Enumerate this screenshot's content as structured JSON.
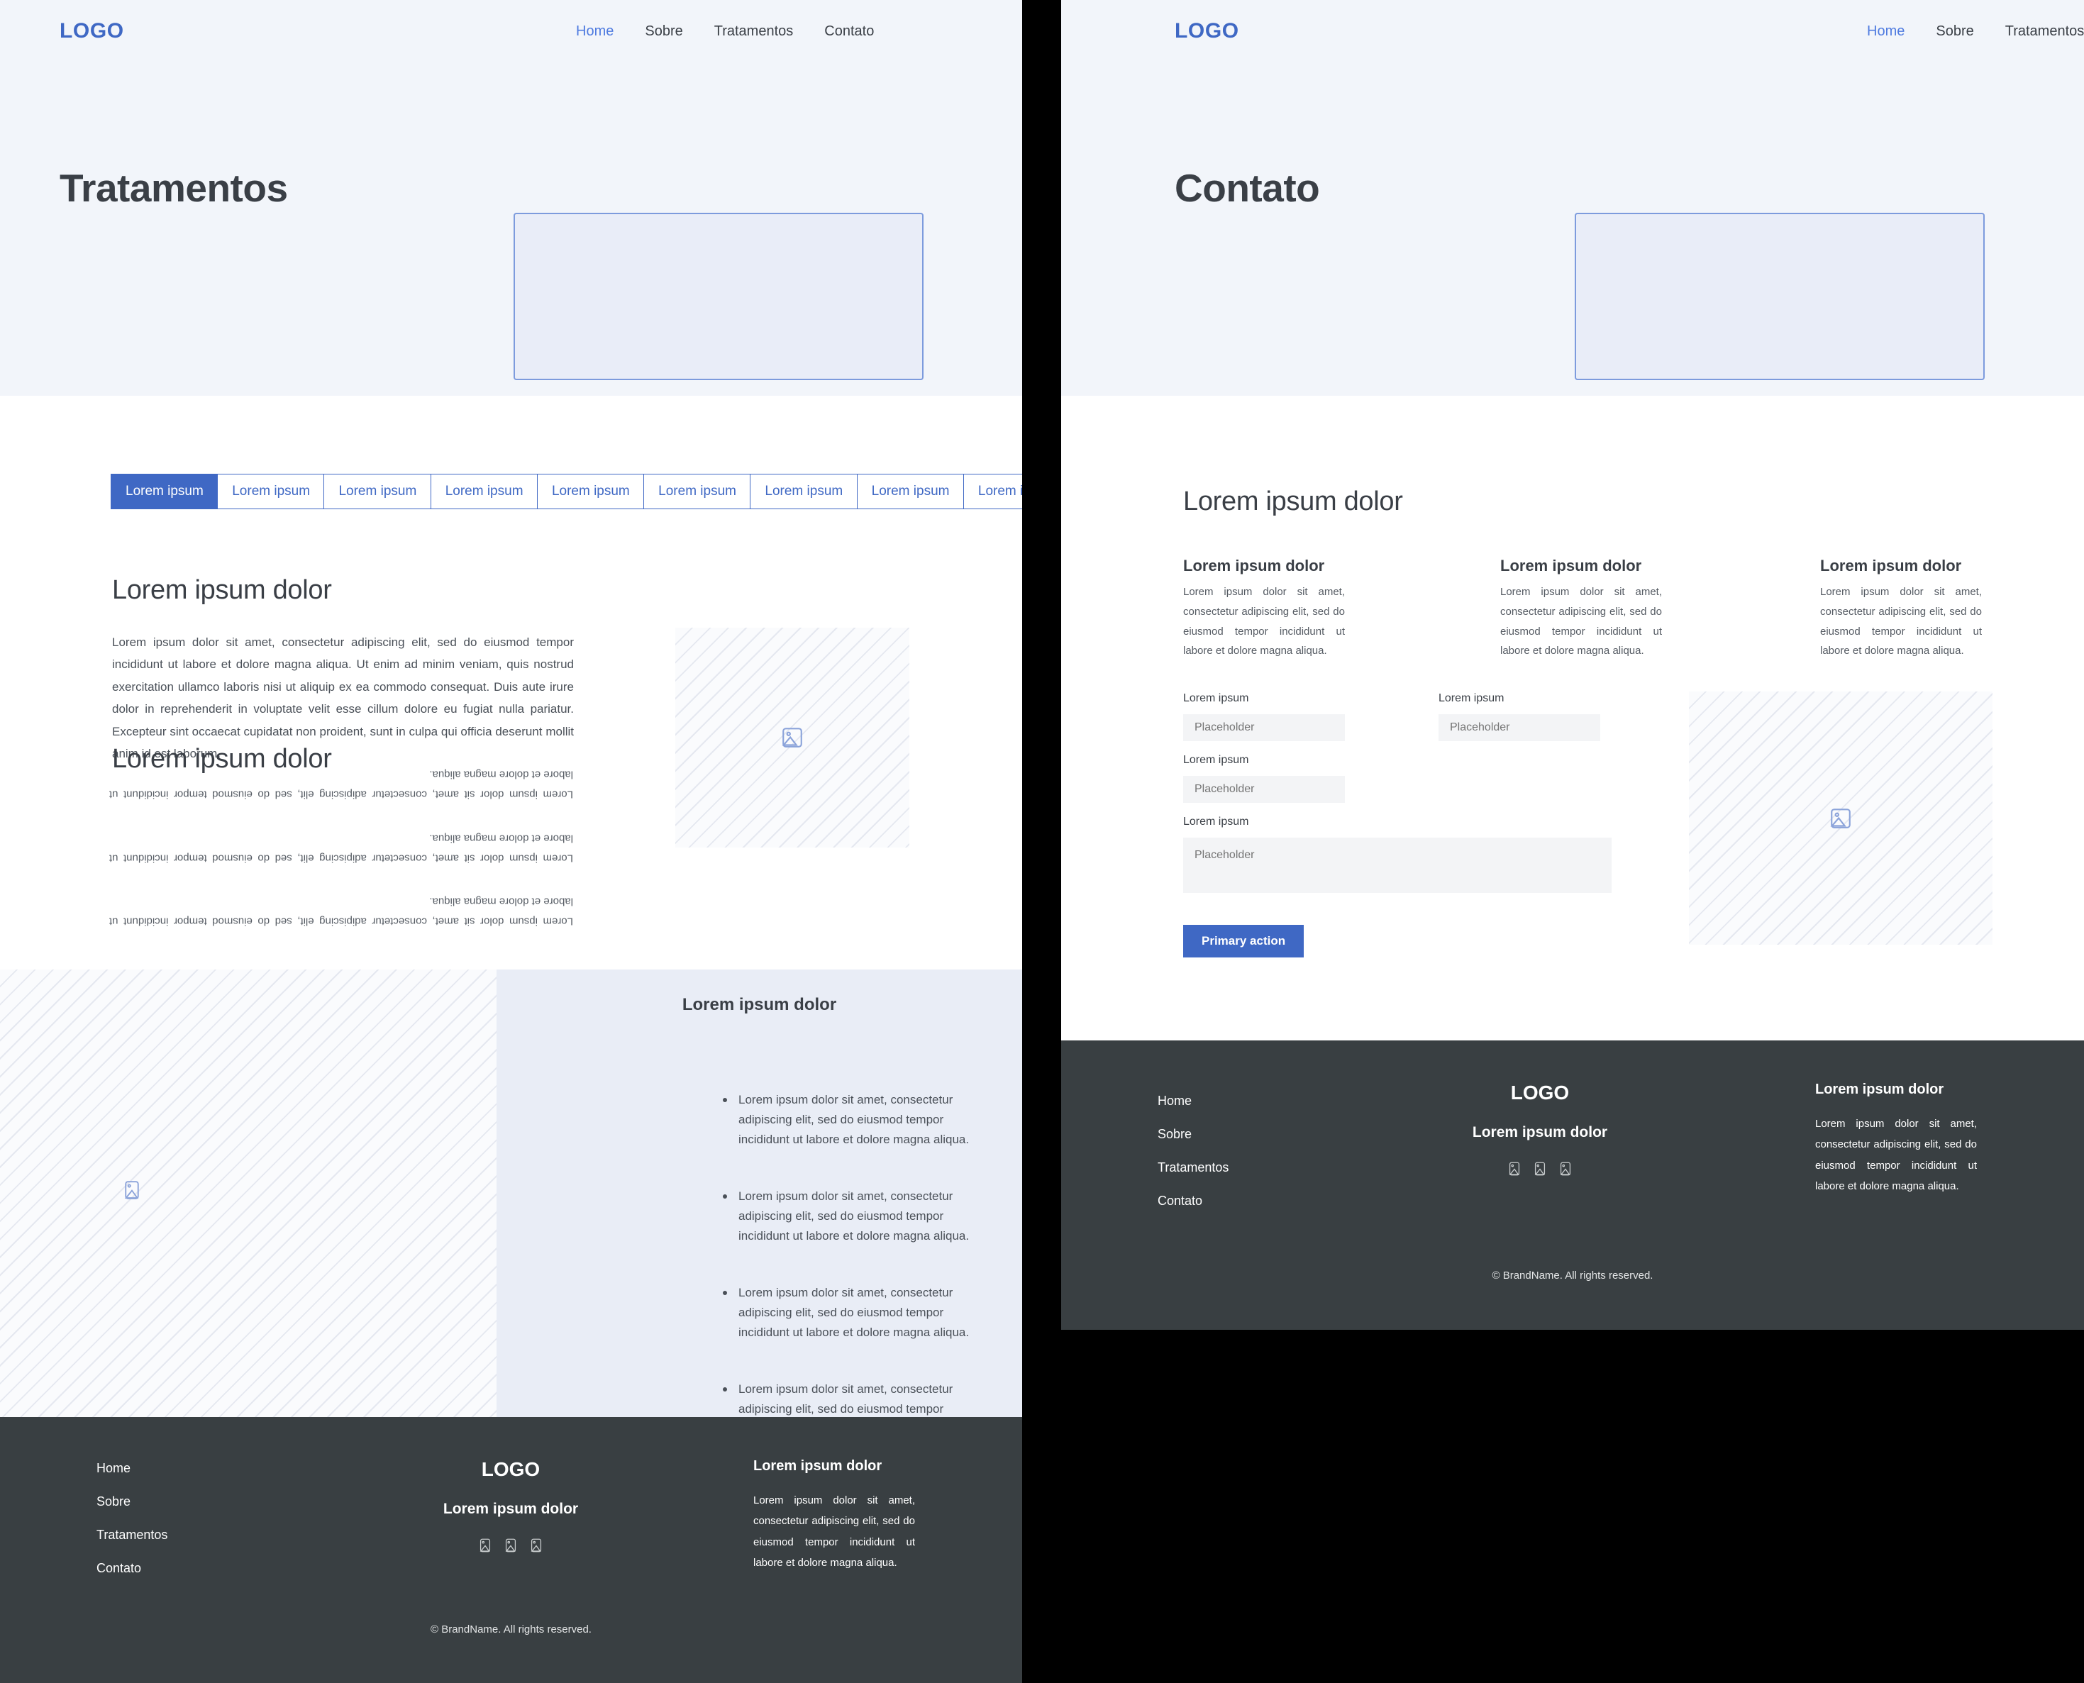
{
  "brand": {
    "logo": "LOGO",
    "accent": "#3f68c4",
    "footer_bg": "#393f42",
    "hero_bg": "#f2f5fa"
  },
  "nav": {
    "items": [
      {
        "label": "Home",
        "active": true
      },
      {
        "label": "Sobre",
        "active": false
      },
      {
        "label": "Tratamentos",
        "active": false
      },
      {
        "label": "Contato",
        "active": false
      }
    ]
  },
  "left_page": {
    "hero_title": "Tratamentos",
    "tabs": [
      {
        "label": "Lorem ipsum",
        "active": true
      },
      {
        "label": "Lorem ipsum",
        "active": false
      },
      {
        "label": "Lorem ipsum",
        "active": false
      },
      {
        "label": "Lorem ipsum",
        "active": false
      },
      {
        "label": "Lorem ipsum",
        "active": false
      },
      {
        "label": "Lorem ipsum",
        "active": false
      },
      {
        "label": "Lorem ipsum",
        "active": false
      },
      {
        "label": "Lorem ipsum",
        "active": false
      },
      {
        "label": "Lorem ipsum",
        "active": false
      }
    ],
    "section_heading": "Lorem ipsum dolor",
    "section_paragraph": "Lorem ipsum dolor sit amet, consectetur adipiscing elit, sed do eiusmod tempor incididunt ut labore et dolore magna aliqua. Ut enim ad minim veniam, quis nostrud exercitation ullamco laboris nisi ut aliquip ex ea commodo consequat. Duis aute irure dolor in reprehenderit in voluptate velit esse cillum dolore eu fugiat nulla pariatur. Excepteur sint occaecat cupidatat non proident, sunt in culpa qui officia deserunt mollit anim id est laborum.",
    "second_heading": "Lorem ipsum dolor",
    "flipped_paragraphs": [
      "Lorem ipsum dolor sit amet, consectetur adipiscing elit, sed do eiusmod tempor incididunt ut labore et dolore magna aliqua.",
      "Lorem ipsum dolor sit amet, consectetur adipiscing elit, sed do eiusmod tempor incididunt ut labore et dolore magna aliqua.",
      "Lorem ipsum dolor sit amet, consectetur adipiscing elit, sed do eiusmod tempor incididunt ut labore et dolore magna aliqua."
    ],
    "list_heading": "Lorem ipsum dolor",
    "list_items": [
      "Lorem ipsum dolor sit amet, consectetur adipiscing elit, sed do eiusmod tempor incididunt ut labore et dolore magna aliqua.",
      "Lorem ipsum dolor sit amet, consectetur adipiscing elit, sed do eiusmod tempor incididunt ut labore et dolore magna aliqua.",
      "Lorem ipsum dolor sit amet, consectetur adipiscing elit, sed do eiusmod tempor incididunt ut labore et dolore magna aliqua.",
      "Lorem ipsum dolor sit amet, consectetur adipiscing elit, sed do eiusmod tempor incididunt ut labore et dolore magna aliqua.",
      "Lorem ipsum dolor sit amet, consectetur adipiscing elit, sed do eiusmod tempor incididunt ut labore et dolore magna aliqua."
    ]
  },
  "right_page": {
    "hero_title": "Contato",
    "section_heading": "Lorem ipsum dolor",
    "cards": [
      {
        "title": "Lorem ipsum dolor",
        "text": "Lorem ipsum dolor sit amet, consectetur adipiscing elit, sed do eiusmod tempor incididunt ut labore et dolore magna aliqua."
      },
      {
        "title": "Lorem ipsum dolor",
        "text": "Lorem ipsum dolor sit amet, consectetur adipiscing elit, sed do eiusmod tempor incididunt ut labore et dolore magna aliqua."
      },
      {
        "title": "Lorem ipsum dolor",
        "text": "Lorem ipsum dolor sit amet, consectetur adipiscing elit, sed do eiusmod tempor incididunt ut labore et dolore magna aliqua."
      }
    ],
    "form": {
      "field1": {
        "label": "Lorem ipsum",
        "placeholder": "Placeholder",
        "value": ""
      },
      "field2": {
        "label": "Lorem ipsum",
        "placeholder": "Placeholder",
        "value": ""
      },
      "field3": {
        "label": "Lorem ipsum",
        "placeholder": "Placeholder",
        "value": ""
      },
      "field4": {
        "label": "Lorem ipsum",
        "placeholder": "Placeholder",
        "value": ""
      },
      "submit_label": "Primary action"
    }
  },
  "footer": {
    "links": [
      "Home",
      "Sobre",
      "Tratamentos",
      "Contato"
    ],
    "logo": "LOGO",
    "tagline": "Lorem ipsum dolor",
    "social_count": 3,
    "about_heading": "Lorem ipsum dolor",
    "about_text": "Lorem ipsum dolor sit amet, consectetur adipiscing elit, sed do eiusmod tempor incididunt ut labore et dolore magna aliqua.",
    "copyright": "© BrandName. All rights reserved."
  }
}
